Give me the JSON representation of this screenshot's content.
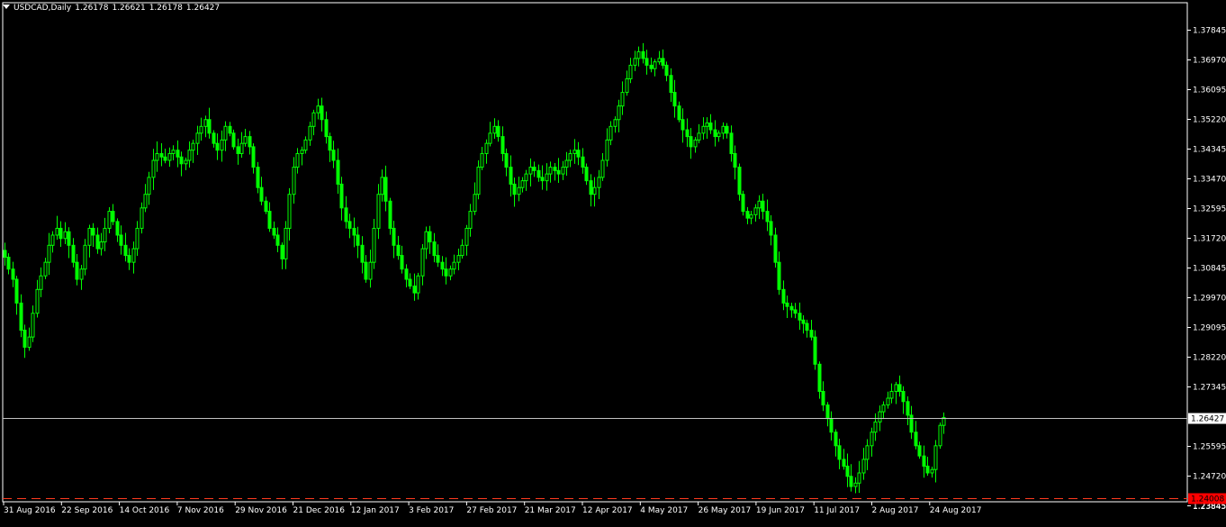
{
  "window": {
    "symbol": "USDCAD,Daily",
    "open": "1.26178",
    "high": "1.26621",
    "low": "1.26178",
    "close": "1.26427"
  },
  "colors": {
    "background": "#000000",
    "foreground": "#ffffff",
    "candle": "#00ff00",
    "price_line": "#c0c0c0",
    "level_line": "#ff3b1f",
    "level_label_bg": "#ff0000"
  },
  "chart_data": {
    "type": "candlestick",
    "current_price": 1.26427,
    "level_price": 1.24008,
    "y_ticks": [
      1.37845,
      1.3697,
      1.36095,
      1.3522,
      1.34345,
      1.3347,
      1.32595,
      1.3172,
      1.30845,
      1.2997,
      1.29095,
      1.2822,
      1.27345,
      1.26427,
      1.25595,
      1.2472,
      1.24008,
      1.23845
    ],
    "y_tick_labels": [
      "1.37845",
      "1.36970",
      "1.36095",
      "1.35220",
      "1.34345",
      "1.33470",
      "1.32595",
      "1.31720",
      "1.30845",
      "1.29970",
      "1.29095",
      "1.28220",
      "1.27345",
      "1.26427",
      "1.25595",
      "1.24720",
      "1.24008",
      "1.23845"
    ],
    "x_tick_labels": [
      "31 Aug 2016",
      "22 Sep 2016",
      "14 Oct 2016",
      "7 Nov 2016",
      "29 Nov 2016",
      "21 Dec 2016",
      "12 Jan 2017",
      "3 Feb 2017",
      "27 Feb 2017",
      "21 Mar 2017",
      "12 Apr 2017",
      "4 May 2017",
      "26 May 2017",
      "19 Jun 2017",
      "11 Jul 2017",
      "2 Aug 2017",
      "24 Aug 2017"
    ],
    "close_series": [
      1.3115,
      1.308,
      1.305,
      1.298,
      1.29,
      1.285,
      1.288,
      1.295,
      1.302,
      1.306,
      1.31,
      1.315,
      1.318,
      1.32,
      1.317,
      1.319,
      1.315,
      1.31,
      1.305,
      1.308,
      1.315,
      1.32,
      1.318,
      1.314,
      1.316,
      1.32,
      1.325,
      1.322,
      1.318,
      1.315,
      1.312,
      1.31,
      1.314,
      1.32,
      1.326,
      1.33,
      1.335,
      1.34,
      1.342,
      1.341,
      1.34,
      1.342,
      1.343,
      1.341,
      1.339,
      1.34,
      1.343,
      1.345,
      1.348,
      1.35,
      1.352,
      1.348,
      1.345,
      1.343,
      1.346,
      1.35,
      1.348,
      1.344,
      1.342,
      1.345,
      1.347,
      1.344,
      1.338,
      1.332,
      1.328,
      1.325,
      1.32,
      1.318,
      1.315,
      1.311,
      1.32,
      1.33,
      1.338,
      1.342,
      1.343,
      1.346,
      1.35,
      1.354,
      1.356,
      1.352,
      1.347,
      1.343,
      1.34,
      1.333,
      1.326,
      1.322,
      1.32,
      1.318,
      1.315,
      1.31,
      1.305,
      1.31,
      1.32,
      1.33,
      1.335,
      1.328,
      1.32,
      1.315,
      1.312,
      1.308,
      1.305,
      1.303,
      1.301,
      1.306,
      1.314,
      1.319,
      1.316,
      1.312,
      1.31,
      1.308,
      1.306,
      1.308,
      1.31,
      1.312,
      1.315,
      1.32,
      1.325,
      1.33,
      1.338,
      1.342,
      1.345,
      1.348,
      1.35,
      1.347,
      1.342,
      1.338,
      1.333,
      1.33,
      1.332,
      1.334,
      1.336,
      1.338,
      1.337,
      1.335,
      1.334,
      1.336,
      1.338,
      1.337,
      1.336,
      1.338,
      1.34,
      1.342,
      1.343,
      1.341,
      1.338,
      1.334,
      1.33,
      1.332,
      1.335,
      1.34,
      1.346,
      1.35,
      1.352,
      1.356,
      1.36,
      1.364,
      1.368,
      1.37,
      1.372,
      1.37,
      1.368,
      1.367,
      1.369,
      1.37,
      1.368,
      1.365,
      1.36,
      1.356,
      1.352,
      1.349,
      1.347,
      1.344,
      1.346,
      1.348,
      1.35,
      1.351,
      1.349,
      1.347,
      1.348,
      1.35,
      1.348,
      1.342,
      1.338,
      1.33,
      1.325,
      1.323,
      1.324,
      1.326,
      1.328,
      1.325,
      1.322,
      1.318,
      1.31,
      1.302,
      1.298,
      1.297,
      1.296,
      1.295,
      1.293,
      1.292,
      1.29,
      1.288,
      1.28,
      1.272,
      1.268,
      1.264,
      1.26,
      1.256,
      1.252,
      1.25,
      1.247,
      1.244,
      1.245,
      1.248,
      1.252,
      1.256,
      1.26,
      1.263,
      1.266,
      1.268,
      1.27,
      1.272,
      1.274,
      1.272,
      1.269,
      1.265,
      1.26,
      1.256,
      1.253,
      1.25,
      1.248,
      1.249,
      1.256,
      1.262,
      1.2643
    ]
  }
}
